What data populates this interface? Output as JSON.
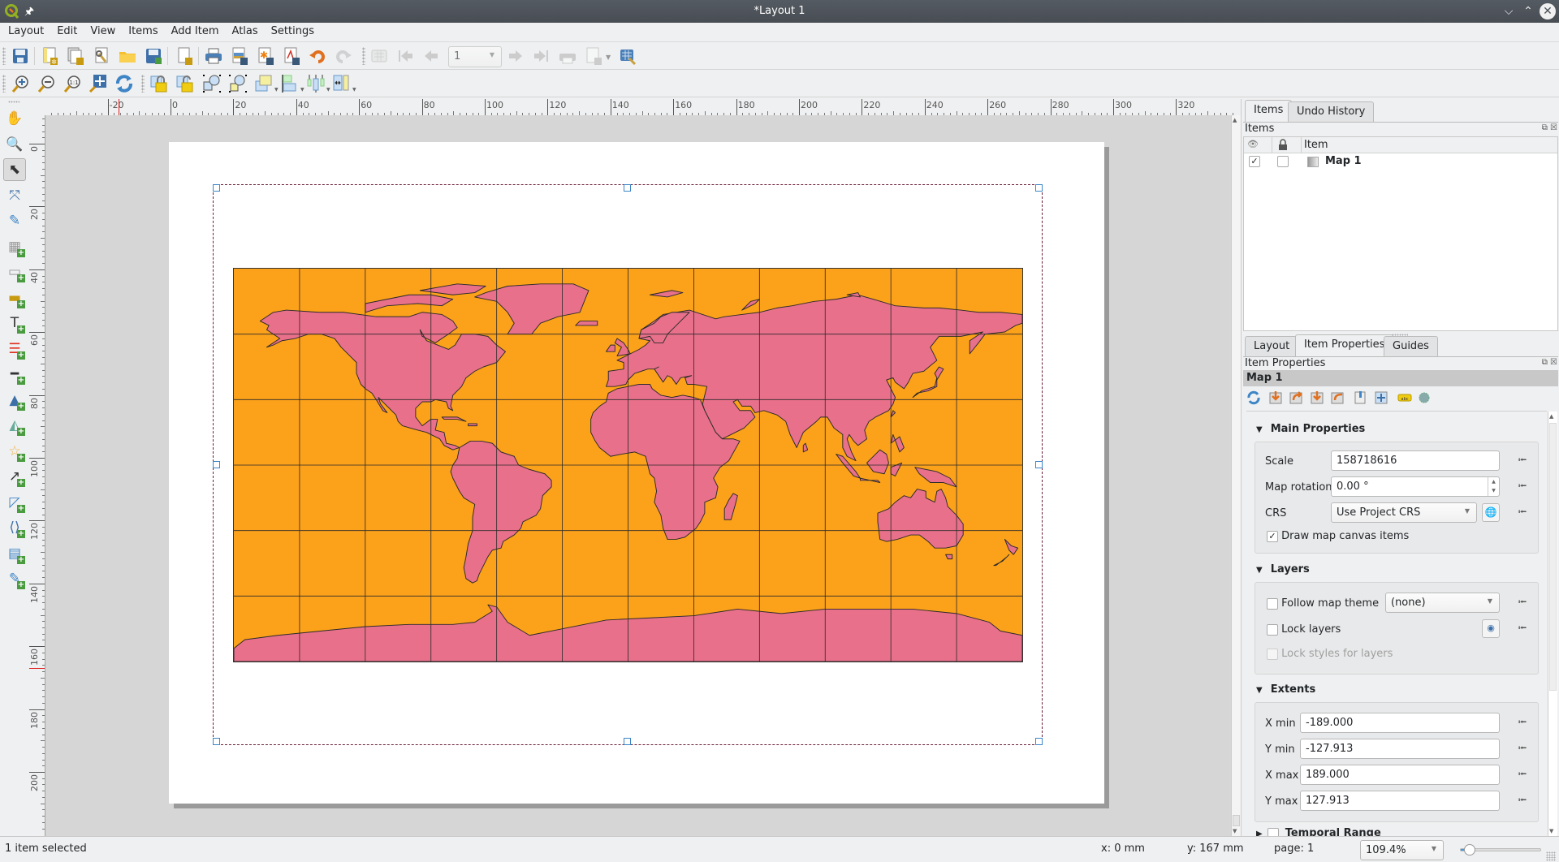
{
  "window": {
    "title": "*Layout 1",
    "controls": [
      "minimize",
      "maximize",
      "close"
    ]
  },
  "menubar": [
    "Layout",
    "Edit",
    "View",
    "Items",
    "Add Item",
    "Atlas",
    "Settings"
  ],
  "toolbar1": {
    "buttons": [
      "save-project",
      "new-layout",
      "duplicate-layout",
      "layout-manager",
      "add-items-from-template",
      "save-as-template",
      "new-page",
      "print",
      "export-image",
      "export-svg",
      "export-pdf",
      "undo",
      "redo",
      "atlas-preview",
      "first-feature",
      "previous-feature",
      "next-feature",
      "last-feature",
      "print-atlas",
      "export-atlas",
      "atlas-settings"
    ],
    "atlas_page_value": "1"
  },
  "toolbar2": {
    "buttons": [
      "zoom-in",
      "zoom-out",
      "zoom-100",
      "zoom-full",
      "refresh",
      "lock-items",
      "unlock-all",
      "group-items",
      "ungroup-items",
      "raise-items",
      "align-items",
      "distribute-items",
      "resize-items"
    ]
  },
  "rulers": {
    "horizontal_labels": [
      "-20",
      "0",
      "20",
      "40",
      "60",
      "80",
      "100",
      "120",
      "140",
      "160",
      "180",
      "200",
      "220",
      "240",
      "260",
      "280",
      "300",
      "320"
    ],
    "vertical_labels": [
      "0",
      "20",
      "40",
      "60",
      "80",
      "100",
      "120",
      "140",
      "160",
      "180",
      "200"
    ]
  },
  "left_tools": [
    "pan-layout",
    "zoom-tool",
    "select-move-item",
    "move-item-content",
    "edit-nodes",
    "add-3d-map",
    "add-map",
    "add-picture",
    "add-label",
    "add-legend",
    "add-scale-bar",
    "add-north-arrow",
    "add-shape",
    "add-marker",
    "add-arrow",
    "add-node-item",
    "add-html",
    "add-attribute-table",
    "add-fixed-table"
  ],
  "map": {
    "background_color": "#fca11a",
    "land_color": "#e8708a",
    "outline_color": "#2a2a2a",
    "graticule_interval_deg": 30
  },
  "items_panel": {
    "tabs": [
      "Items",
      "Undo History"
    ],
    "active_tab": "Items",
    "header": "Items",
    "columns": [
      "",
      "",
      "Item"
    ],
    "rows": [
      {
        "visible": true,
        "locked": false,
        "name": "Map 1"
      }
    ]
  },
  "properties_panel": {
    "tabs": [
      "Layout",
      "Item Properties",
      "Guides"
    ],
    "active_tab": "Item Properties",
    "header": "Item Properties",
    "item_name": "Map 1",
    "main_properties": {
      "title": "Main Properties",
      "scale_label": "Scale",
      "scale_value": "158718616",
      "rotation_label": "Map rotation",
      "rotation_value": "0.00 °",
      "crs_label": "CRS",
      "crs_value": "Use Project CRS",
      "draw_canvas_items_label": "Draw map canvas items",
      "draw_canvas_items_checked": true
    },
    "layers": {
      "title": "Layers",
      "follow_theme_label": "Follow map theme",
      "follow_theme_checked": false,
      "theme_value": "(none)",
      "lock_layers_label": "Lock layers",
      "lock_layers_checked": false,
      "lock_styles_label": "Lock styles for layers",
      "lock_styles_checked": false
    },
    "extents": {
      "title": "Extents",
      "xmin_label": "X min",
      "xmin": "-189.000",
      "ymin_label": "Y min",
      "ymin": "-127.913",
      "xmax_label": "X max",
      "xmax": "189.000",
      "ymax_label": "Y max",
      "ymax": "127.913"
    },
    "temporal": {
      "title": "Temporal Range",
      "checked": false
    }
  },
  "statusbar": {
    "selection": "1 item selected",
    "x": "x: 0 mm",
    "y": "y: 167 mm",
    "page": "page: 1",
    "zoom": "109.4%",
    "zoom_slider_fraction": 0.08
  }
}
